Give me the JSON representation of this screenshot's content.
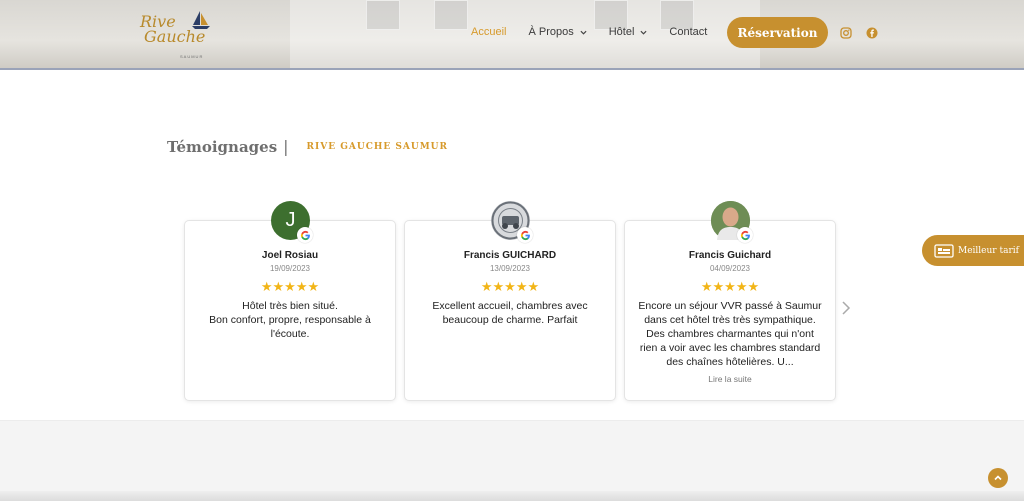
{
  "brand": {
    "logo_line1": "Rive",
    "logo_line2": "Gauche",
    "logo_sub": "SAUMUR"
  },
  "nav": {
    "items": [
      {
        "label": "Accueil",
        "active": true,
        "has_dropdown": false
      },
      {
        "label": "À Propos",
        "active": false,
        "has_dropdown": true
      },
      {
        "label": "Hôtel",
        "active": false,
        "has_dropdown": true
      },
      {
        "label": "Contact",
        "active": false,
        "has_dropdown": false
      }
    ],
    "reserve_label": "Réservation",
    "social": [
      "instagram-icon",
      "facebook-icon"
    ]
  },
  "section": {
    "title": "Témoignages",
    "separator": "|",
    "subtitle": "RIVE GAUCHE SAUMUR"
  },
  "reviews": [
    {
      "name": "Joel Rosiau",
      "date": "19/09/2023",
      "rating": 5,
      "avatar_letter": "J",
      "text": "Hôtel très bien situé.\nBon confort, propre, responsable à l'écoute.",
      "read_more": ""
    },
    {
      "name": "Francis GUICHARD",
      "date": "13/09/2023",
      "rating": 5,
      "avatar_letter": "",
      "text": "Excellent accueil, chambres avec beaucoup de charme. Parfait",
      "read_more": ""
    },
    {
      "name": "Francis Guichard",
      "date": "04/09/2023",
      "rating": 5,
      "avatar_letter": "",
      "text": "Encore un séjour VVR passé à Saumur dans cet hôtel très très sympathique. Des chambres charmantes qui n'ont rien a voir avec les chambres standard des chaînes hôtelières. U...",
      "read_more": "Lire la suite"
    }
  ],
  "stars_text": "★★★★★",
  "best_rate_label": "Meilleur tarif",
  "colors": {
    "accent": "#c7902f",
    "nav_active": "#d79a2b",
    "star": "#f2b517"
  }
}
